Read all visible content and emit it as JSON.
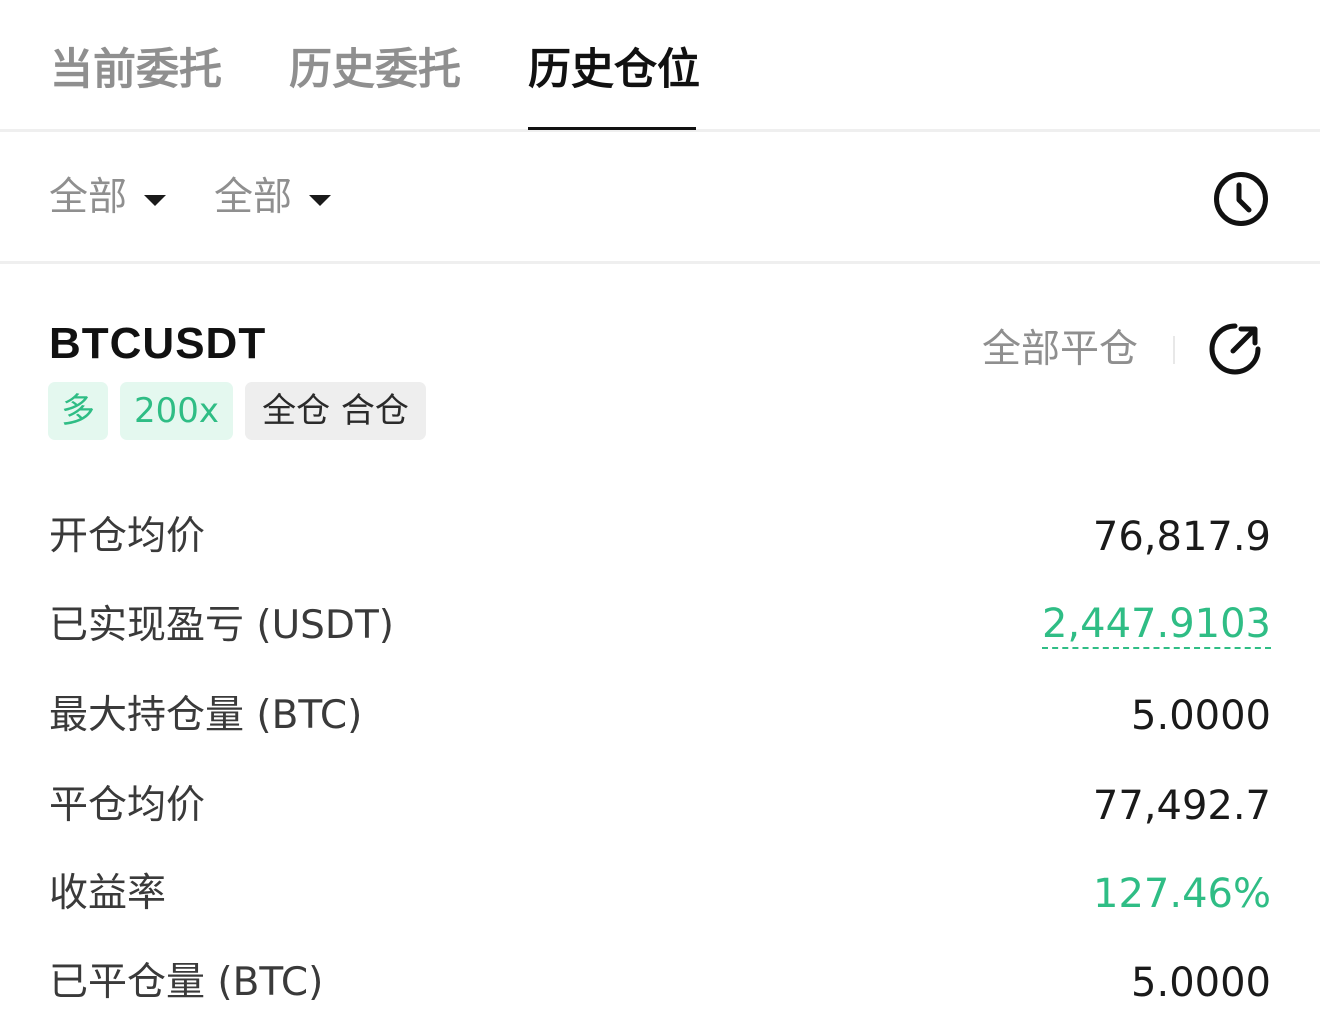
{
  "tabs": {
    "items": [
      {
        "label": "当前委托",
        "active": false
      },
      {
        "label": "历史委托",
        "active": false
      },
      {
        "label": "历史仓位",
        "active": true
      }
    ]
  },
  "filters": {
    "first": {
      "label": "全部",
      "icon": "caret-down-icon"
    },
    "second": {
      "label": "全部",
      "icon": "caret-down-icon"
    },
    "history_icon": "clock-icon"
  },
  "position": {
    "symbol": "BTCUSDT",
    "close_all_label": "全部平仓",
    "share_icon": "share-arrow-icon",
    "tags": {
      "side": "多",
      "leverage": "200x",
      "mode": "全仓 合仓"
    },
    "rows": [
      {
        "label": "开仓均价",
        "value": "76,817.9"
      },
      {
        "label": "已实现盈亏 (USDT)",
        "value": "2,447.9103"
      },
      {
        "label": "最大持仓量 (BTC)",
        "value": "5.0000"
      },
      {
        "label": "平仓均价",
        "value": "77,492.7"
      },
      {
        "label": "收益率",
        "value": "127.46%"
      },
      {
        "label": "已平仓量 (BTC)",
        "value": "5.0000"
      }
    ]
  },
  "colors": {
    "positive": "#2fbd85",
    "text_primary": "#111111",
    "text_secondary": "#8f8f8f",
    "divider": "#efefef"
  }
}
